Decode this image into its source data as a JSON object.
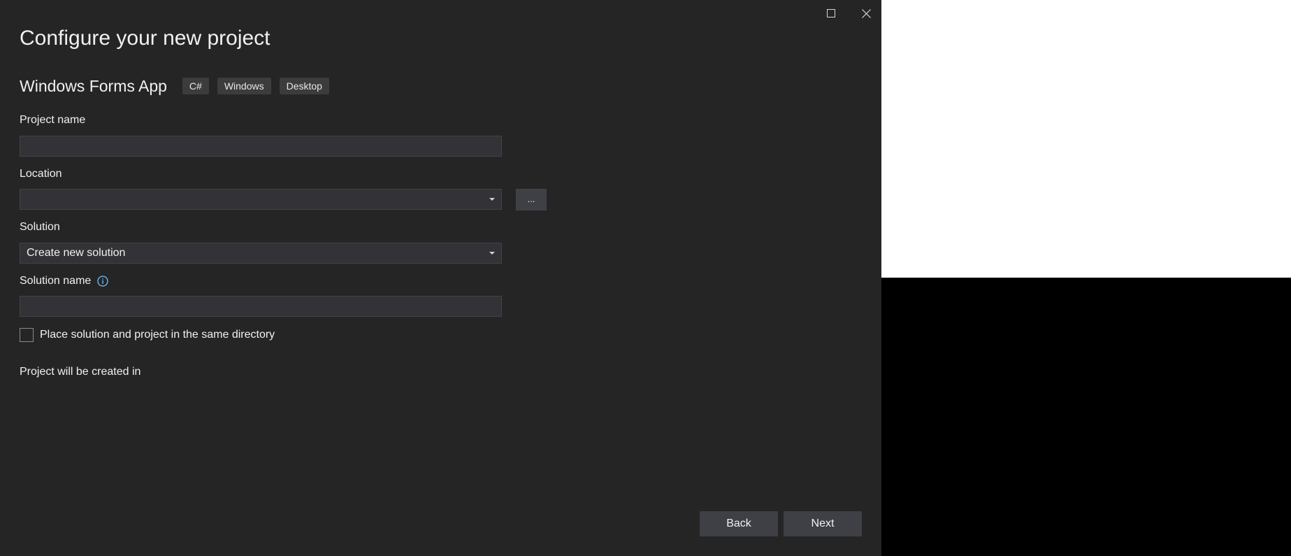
{
  "page": {
    "title": "Configure your new project"
  },
  "template": {
    "name": "Windows Forms App",
    "tags": [
      "C#",
      "Windows",
      "Desktop"
    ]
  },
  "form": {
    "project_name": {
      "label": "Project name",
      "value": ""
    },
    "location": {
      "label": "Location",
      "value": "",
      "browse_label": "..."
    },
    "solution": {
      "label": "Solution",
      "selected": "Create new solution"
    },
    "solution_name": {
      "label": "Solution name",
      "value": "",
      "info_icon": "info-icon"
    },
    "same_directory": {
      "label": "Place solution and project in the same directory",
      "checked": false
    },
    "created_in_label": "Project will be created in"
  },
  "footer": {
    "back_label": "Back",
    "next_label": "Next"
  },
  "window_controls": {
    "maximize_icon": "maximize-icon",
    "close_icon": "close-icon"
  },
  "colors": {
    "dialog_bg": "#252526",
    "input_bg": "#333337",
    "button_bg": "#3f3f46",
    "info_accent": "#75beff"
  }
}
